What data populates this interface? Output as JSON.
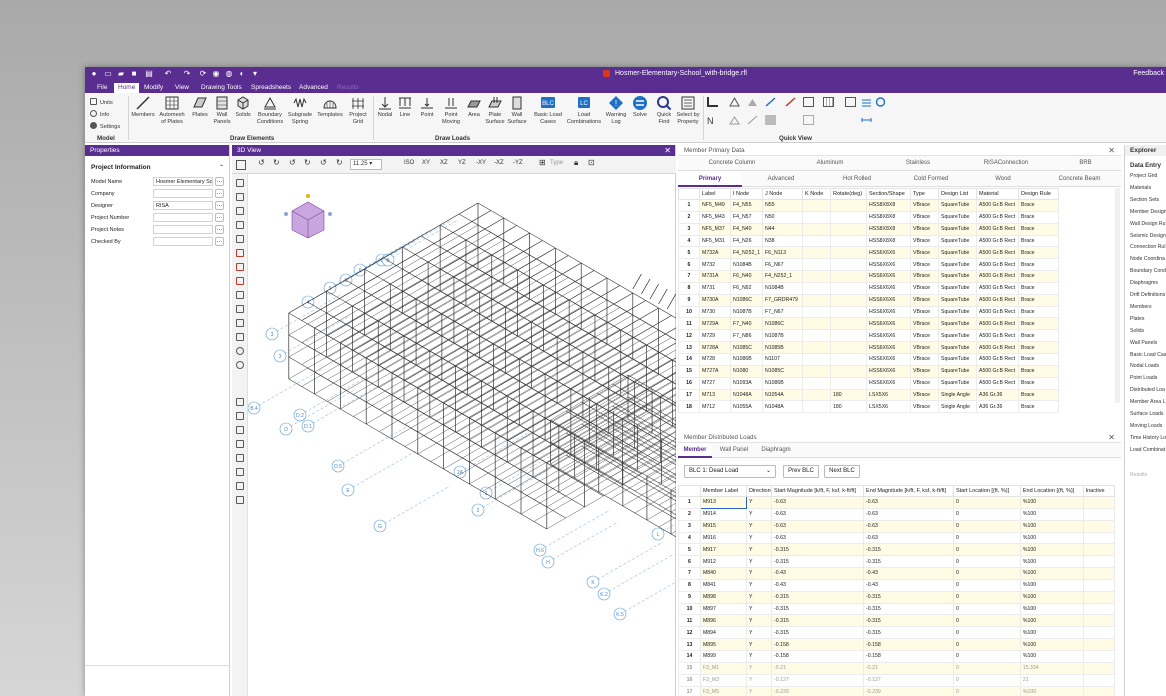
{
  "window": {
    "title": "Hosmer-Elementary-School_with-bridge.rfl",
    "feedback": "Feedback"
  },
  "menu": [
    "File",
    "Home",
    "Modify",
    "View",
    "Drawing Tools",
    "Spreadsheets",
    "Advanced",
    "Results"
  ],
  "ribbon": {
    "model_small": [
      "Units",
      "Info",
      "Settings"
    ],
    "draw_elements": [
      "Members",
      "Automesh of Plates",
      "Plates",
      "Wall Panels",
      "Solids",
      "Boundary Conditions",
      "Subgrade Spring",
      "Templates",
      "Project Grid"
    ],
    "draw_loads": [
      "Nodal",
      "Line",
      "Point",
      "Point Moving",
      "Area",
      "Plate Surface",
      "Wall Surface",
      "Basic Load Cases",
      "Load Combinations",
      "Warning Log",
      "Solve",
      "Quick Find",
      "Select by Property"
    ],
    "group_labels": {
      "model": "Model",
      "draw_elements": "Draw Elements",
      "draw_loads": "Draw Loads",
      "quick_view": "Quick View"
    }
  },
  "properties": {
    "header": "Properties",
    "section": "Project Information",
    "fields": [
      {
        "label": "Model Name",
        "value": "Hosmer Elementary Sch"
      },
      {
        "label": "Company",
        "value": ""
      },
      {
        "label": "Designer",
        "value": "RISA"
      },
      {
        "label": "Project Number",
        "value": ""
      },
      {
        "label": "Project Notes",
        "value": ""
      },
      {
        "label": "Checked By",
        "value": ""
      }
    ]
  },
  "view3d": {
    "header": "3D View",
    "zoom": "11.25",
    "view_buttons": [
      "ISO",
      "XY",
      "XZ",
      "YZ",
      "-XY",
      "-XZ",
      "-YZ"
    ],
    "type_label": "Type"
  },
  "member_primary": {
    "header": "Member Primary Data",
    "tabs_row1": [
      "Concrete Column",
      "Aluminum",
      "Stainless",
      "RISAConnection",
      "BRB"
    ],
    "tabs_row2": [
      "Primary",
      "Advanced",
      "Hot Rolled",
      "Cold Formed",
      "Wood",
      "Concrete Beam"
    ],
    "columns": [
      "",
      "Label",
      "I Node",
      "J Node",
      "K Node",
      "Rotate(deg)",
      "Section/Shape",
      "Type",
      "Design List",
      "Material",
      "Design Rule"
    ],
    "rows": [
      [
        "1",
        "NF5_M49",
        "F4_N55",
        "N55",
        "",
        "",
        "HSS8X8X8",
        "VBrace",
        "SquareTube",
        "A500 Gr.B Rect",
        "Brace"
      ],
      [
        "2",
        "NF5_M43",
        "F4_N57",
        "N50",
        "",
        "",
        "HSS8X8X8",
        "VBrace",
        "SquareTube",
        "A500 Gr.B Rect",
        "Brace"
      ],
      [
        "3",
        "NF5_M37",
        "F4_N40",
        "N44",
        "",
        "",
        "HSS8X8X8",
        "VBrace",
        "SquareTube",
        "A500 Gr.B Rect",
        "Brace"
      ],
      [
        "4",
        "NF5_M31",
        "F4_N26",
        "N38",
        "",
        "",
        "HSS8X8X8",
        "VBrace",
        "SquareTube",
        "A500 Gr.B Rect",
        "Brace"
      ],
      [
        "5",
        "M732A",
        "F4_N252_1",
        "F6_N113",
        "",
        "",
        "HSS6X6X6",
        "VBrace",
        "SquareTube",
        "A500 Gr.B Rect",
        "Brace"
      ],
      [
        "6",
        "M732",
        "N1084B",
        "F6_N67",
        "",
        "",
        "HSS6X6X6",
        "VBrace",
        "SquareTube",
        "A500 Gr.B Rect",
        "Brace"
      ],
      [
        "7",
        "M731A",
        "F6_N40",
        "F4_N252_1",
        "",
        "",
        "HSS6X6X6",
        "VBrace",
        "SquareTube",
        "A500 Gr.B Rect",
        "Brace"
      ],
      [
        "8",
        "M731",
        "F6_N92",
        "N1084B",
        "",
        "",
        "HSS6X6X6",
        "VBrace",
        "SquareTube",
        "A500 Gr.B Rect",
        "Brace"
      ],
      [
        "9",
        "M730A",
        "N1086C",
        "F7_GRDR479",
        "",
        "",
        "HSS6X6X6",
        "VBrace",
        "SquareTube",
        "A500 Gr.B Rect",
        "Brace"
      ],
      [
        "10",
        "M730",
        "N1087B",
        "F7_N67",
        "",
        "",
        "HSS6X6X6",
        "VBrace",
        "SquareTube",
        "A500 Gr.B Rect",
        "Brace"
      ],
      [
        "11",
        "M729A",
        "F7_N40",
        "N1086C",
        "",
        "",
        "HSS6X6X6",
        "VBrace",
        "SquareTube",
        "A500 Gr.B Rect",
        "Brace"
      ],
      [
        "12",
        "M729",
        "F7_N86",
        "N1087B",
        "",
        "",
        "HSS6X6X6",
        "VBrace",
        "SquareTube",
        "A500 Gr.B Rect",
        "Brace"
      ],
      [
        "13",
        "M728A",
        "N1085C",
        "N1085B",
        "",
        "",
        "HSS6X6X6",
        "VBrace",
        "SquareTube",
        "A500 Gr.B Rect",
        "Brace"
      ],
      [
        "14",
        "M728",
        "N1086B",
        "N1107",
        "",
        "",
        "HSS6X6X6",
        "VBrace",
        "SquareTube",
        "A500 Gr.B Rect",
        "Brace"
      ],
      [
        "15",
        "M727A",
        "N1080",
        "N1085C",
        "",
        "",
        "HSS6X6X6",
        "VBrace",
        "SquareTube",
        "A500 Gr.B Rect",
        "Brace"
      ],
      [
        "16",
        "M727",
        "N1093A",
        "N1086B",
        "",
        "",
        "HSS6X6X6",
        "VBrace",
        "SquareTube",
        "A500 Gr.B Rect",
        "Brace"
      ],
      [
        "17",
        "M713",
        "N1048A",
        "N1054A",
        "",
        "180",
        "LSX5X6",
        "VBrace",
        "Single Angle",
        "A36 Gr.36",
        "Brace"
      ],
      [
        "18",
        "M712",
        "N1055A",
        "N1048A",
        "",
        "180",
        "LSX5X6",
        "VBrace",
        "Single Angle",
        "A36 Gr.36",
        "Brace"
      ]
    ]
  },
  "distributed": {
    "header": "Member Distributed Loads",
    "tabs": [
      "Member",
      "Wall Panel",
      "Diaphragm"
    ],
    "blc_select": "BLC 1: Dead Load",
    "prev": "Prev BLC",
    "next": "Next BLC",
    "columns": [
      "",
      "Member Label",
      "Direction",
      "Start Magnitude [k/ft, F, ksf, k-ft/ft]",
      "End Magnitude [k/ft, F, ksf, k-ft/ft]",
      "Start Location [(ft, %)]",
      "End Location [(ft, %)]",
      "Inactive"
    ],
    "rows": [
      [
        "1",
        "M913",
        "Y",
        "-0.63",
        "-0.63",
        "0",
        "%100",
        ""
      ],
      [
        "2",
        "M914",
        "Y",
        "-0.63",
        "-0.63",
        "0",
        "%100",
        ""
      ],
      [
        "3",
        "M915",
        "Y",
        "-0.63",
        "-0.63",
        "0",
        "%100",
        ""
      ],
      [
        "4",
        "M916",
        "Y",
        "-0.63",
        "-0.63",
        "0",
        "%100",
        ""
      ],
      [
        "5",
        "M917",
        "Y",
        "-0.315",
        "-0.315",
        "0",
        "%100",
        ""
      ],
      [
        "6",
        "M912",
        "Y",
        "-0.315",
        "-0.315",
        "0",
        "%100",
        ""
      ],
      [
        "7",
        "M840",
        "Y",
        "-0.43",
        "-0.43",
        "0",
        "%100",
        ""
      ],
      [
        "8",
        "M841",
        "Y",
        "-0.43",
        "-0.43",
        "0",
        "%100",
        ""
      ],
      [
        "9",
        "M898",
        "Y",
        "-0.315",
        "-0.315",
        "0",
        "%100",
        ""
      ],
      [
        "10",
        "M897",
        "Y",
        "-0.315",
        "-0.315",
        "0",
        "%100",
        ""
      ],
      [
        "11",
        "M896",
        "Y",
        "-0.315",
        "-0.315",
        "0",
        "%100",
        ""
      ],
      [
        "12",
        "M894",
        "Y",
        "-0.315",
        "-0.315",
        "0",
        "%100",
        ""
      ],
      [
        "13",
        "M895",
        "Y",
        "-0.158",
        "-0.158",
        "0",
        "%100",
        ""
      ],
      [
        "14",
        "M899",
        "Y",
        "-0.158",
        "-0.158",
        "0",
        "%100",
        ""
      ],
      [
        "15",
        "F3_M1",
        "Y",
        "-0.21",
        "-0.21",
        "0",
        "15.334",
        ""
      ],
      [
        "16",
        "F3_M3",
        "Y",
        "-0.127",
        "-0.127",
        "0",
        "21",
        ""
      ],
      [
        "17",
        "F3_M5",
        "Y",
        "-0.239",
        "-0.239",
        "0",
        "%100",
        ""
      ]
    ]
  },
  "explorer": {
    "header": "Explorer",
    "section": "Data Entry",
    "items": [
      "Project Grid",
      "Materials",
      "Section Sets",
      "Member Design",
      "Wall Design Ru",
      "Seismic Design",
      "Connection Rul",
      "Node Coordina",
      "Boundary Cond",
      "Diaphragms",
      "Drift Definitions",
      "Members",
      "Plates",
      "Solids",
      "Wall Panels",
      "Basic Load Case",
      "Nodal Loads",
      "Point Loads",
      "Distributed Loa",
      "Member Area L",
      "Surface Loads",
      "Moving Loads",
      "Time History Lo",
      "Load Combinat"
    ],
    "results": "Results"
  },
  "grid_labels": [
    "B",
    "B",
    "6",
    "5",
    "5",
    "4",
    "3",
    "3",
    "B.4",
    "D.2",
    "D.1",
    "D",
    "D.5",
    "E",
    "2A",
    "2",
    "G",
    "2",
    "H.6",
    "H",
    "K",
    "K.2",
    "K.5",
    "L"
  ],
  "colors": {
    "accent": "#5a2d91",
    "row_highlight": "#fffbe5"
  }
}
